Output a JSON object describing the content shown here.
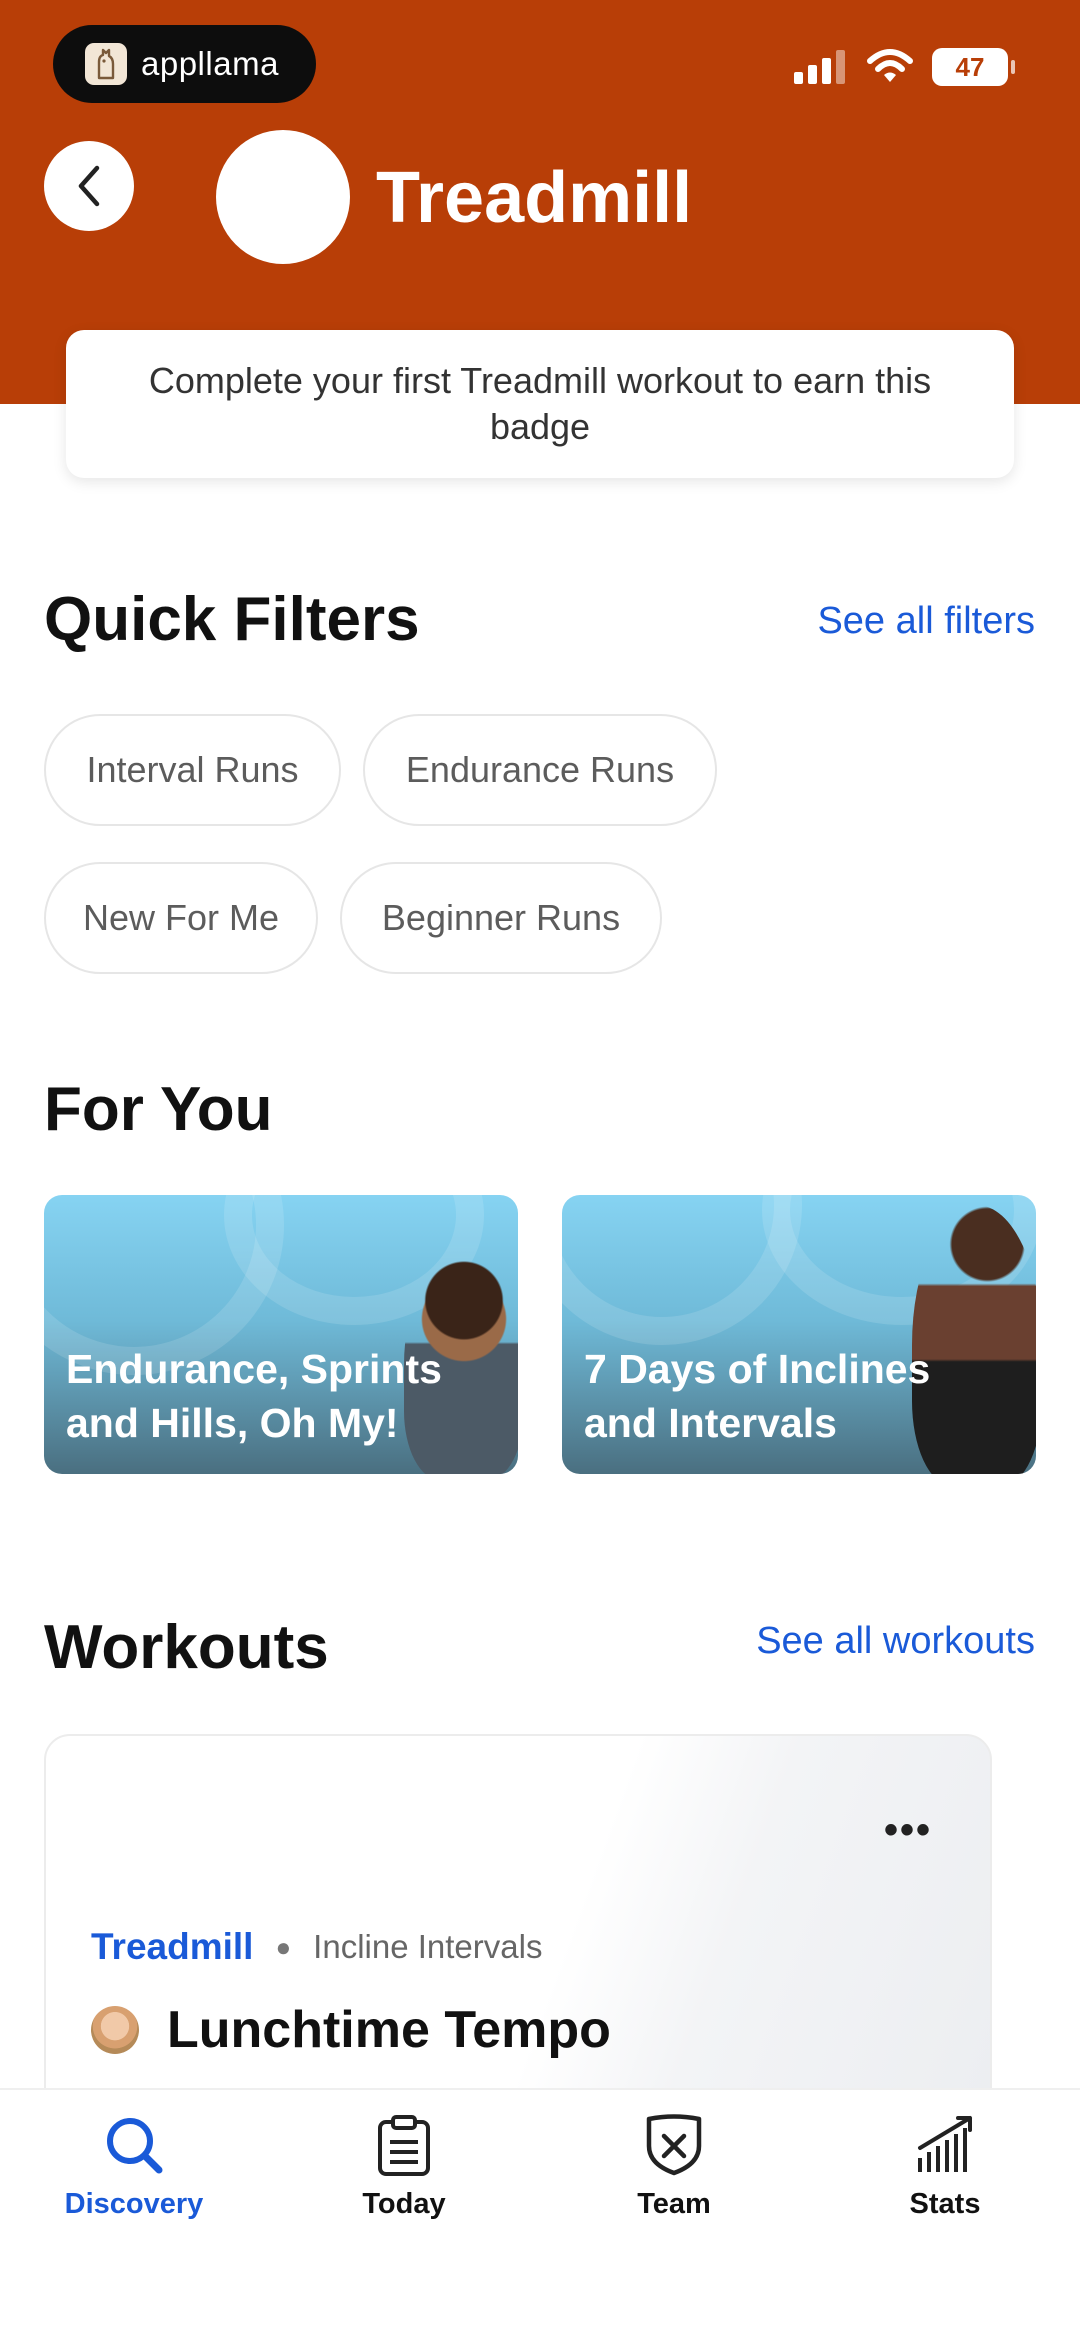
{
  "status_bar": {
    "app_badge_label": "appllama",
    "battery": "47"
  },
  "header": {
    "title": "Treadmill",
    "badge_message": "Complete your first Treadmill workout to earn this badge"
  },
  "quick_filters": {
    "title": "Quick Filters",
    "see_all_label": "See all filters",
    "chips": [
      "Interval Runs",
      "Endurance Runs",
      "New For Me",
      "Beginner Runs"
    ]
  },
  "for_you": {
    "title": "For You",
    "cards": [
      {
        "title": "Endurance, Sprints and Hills, Oh My!"
      },
      {
        "title": "7 Days of Inclines and Intervals"
      }
    ]
  },
  "workouts": {
    "title": "Workouts",
    "see_all_label": "See all workouts",
    "items": [
      {
        "category": "Treadmill",
        "subcategory": "Incline Intervals",
        "title": "Lunchtime Tempo",
        "more_label": "•••"
      }
    ]
  },
  "tabbar": {
    "tabs": [
      {
        "label": "Discovery",
        "icon": "search-icon",
        "active": true
      },
      {
        "label": "Today",
        "icon": "clipboard-icon",
        "active": false
      },
      {
        "label": "Team",
        "icon": "shield-icon",
        "active": false
      },
      {
        "label": "Stats",
        "icon": "chart-icon",
        "active": false
      }
    ]
  },
  "colors": {
    "header_bg": "#b83e07",
    "accent_blue": "#1a5ad8"
  }
}
